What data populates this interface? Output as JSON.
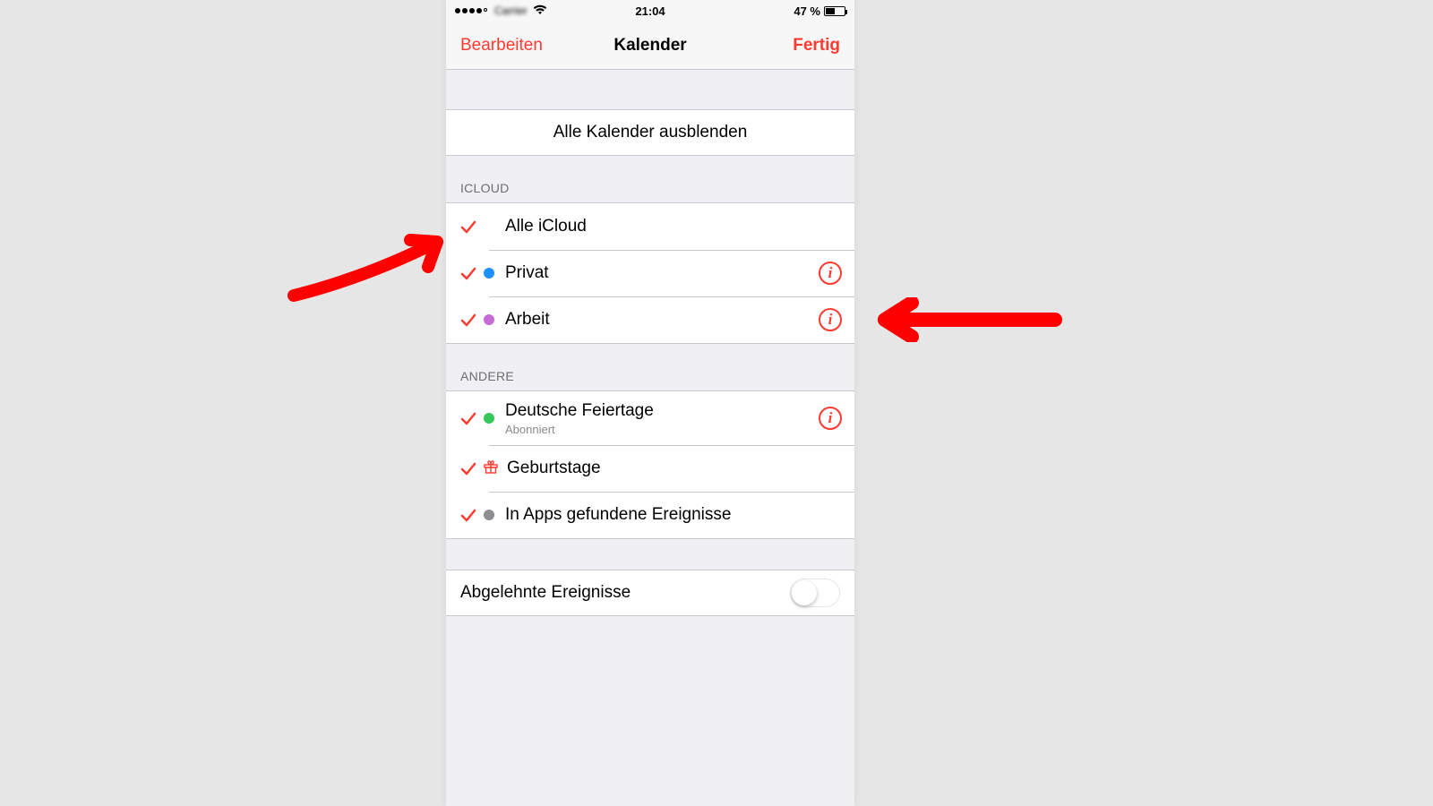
{
  "statusbar": {
    "carrier": "•••••",
    "time": "21:04",
    "battery_text": "47 %"
  },
  "nav": {
    "left": "Bearbeiten",
    "title": "Kalender",
    "right": "Fertig"
  },
  "hide_all": "Alle Kalender ausblenden",
  "sections": {
    "icloud": {
      "header": "ICLOUD",
      "items": [
        {
          "label": "Alle iCloud",
          "dot": null,
          "info": false
        },
        {
          "label": "Privat",
          "dot": "#1e90ff",
          "info": true
        },
        {
          "label": "Arbeit",
          "dot": "#c66bd5",
          "info": true
        }
      ]
    },
    "other": {
      "header": "ANDERE",
      "items": [
        {
          "label": "Deutsche Feiertage",
          "sub": "Abonniert",
          "dot": "#34c759",
          "info": true,
          "icon": null
        },
        {
          "label": "Geburtstage",
          "sub": null,
          "dot": null,
          "info": false,
          "icon": "gift"
        },
        {
          "label": "In Apps gefundene Ereignisse",
          "sub": null,
          "dot": "#8e8e93",
          "info": false,
          "icon": null
        }
      ]
    }
  },
  "declined": {
    "label": "Abgelehnte Ereignisse",
    "on": false
  },
  "colors": {
    "accent": "#ff3b30"
  }
}
